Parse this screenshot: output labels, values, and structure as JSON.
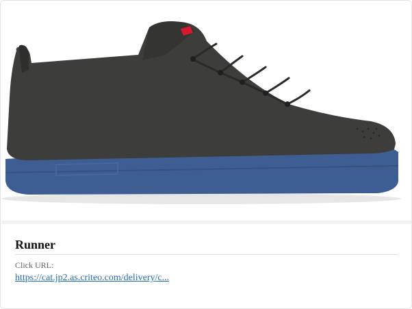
{
  "product": {
    "image_alt": "Runner",
    "icon": "sneaker-image",
    "colors": {
      "upper": "#3d3d3c",
      "sole": "#3e5e93",
      "accent": "#d8192d"
    }
  },
  "details": {
    "title": "Runner",
    "click_label": "Click URL:",
    "click_url_text": "https://cat.jp2.as.criteo.com/delivery/c..."
  }
}
